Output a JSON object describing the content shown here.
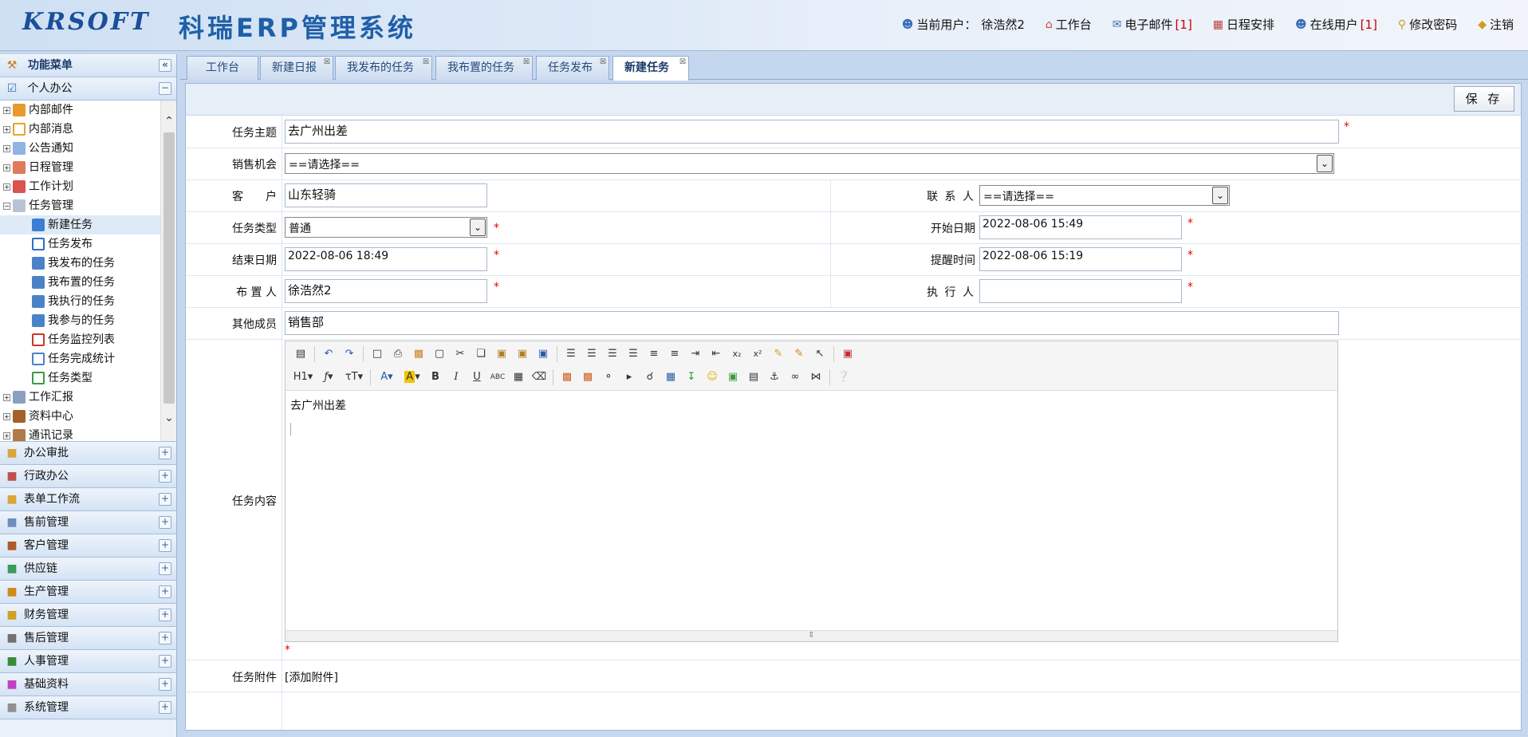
{
  "header": {
    "logo_text": "KRSOFT",
    "system_name": "科瑞ERP管理系统",
    "current_user_label": "当前用户：",
    "current_user": "徐浩然2",
    "nav": {
      "workbench": "工作台",
      "email": "电子邮件",
      "email_count": "[1]",
      "schedule": "日程安排",
      "online_users": "在线用户",
      "online_count": "[1]",
      "change_password": "修改密码",
      "logout": "注销"
    }
  },
  "sidebar": {
    "title": "功能菜单",
    "collapse_symbol": "«",
    "personal_office": "个人办公",
    "tree": {
      "internal_mail": "内部邮件",
      "internal_msg": "内部消息",
      "notice": "公告通知",
      "schedule_mgmt": "日程管理",
      "work_plan": "工作计划",
      "task_mgmt": "任务管理",
      "new_task": "新建任务",
      "task_publish": "任务发布",
      "my_published": "我发布的任务",
      "my_assigned": "我布置的任务",
      "my_executed": "我执行的任务",
      "my_participated": "我参与的任务",
      "task_monitor": "任务监控列表",
      "task_stats": "任务完成统计",
      "task_type": "任务类型",
      "work_report": "工作汇报",
      "data_center": "资料中心",
      "contacts": "通讯记录"
    },
    "sections": [
      "办公审批",
      "行政办公",
      "表单工作流",
      "售前管理",
      "客户管理",
      "供应链",
      "生产管理",
      "财务管理",
      "售后管理",
      "人事管理",
      "基础资料",
      "系统管理"
    ]
  },
  "tabs": [
    "工作台",
    "新建日报",
    "我发布的任务",
    "我布置的任务",
    "任务发布",
    "新建任务"
  ],
  "form": {
    "save_label": "保 存",
    "subject_label": "任务主题",
    "subject_value": "去广州出差",
    "opportunity_label": "销售机会",
    "opportunity_value": "==请选择==",
    "customer_label": "客　　户",
    "customer_value": "山东轻骑",
    "contact_label": "联 系 人",
    "contact_value": "==请选择==",
    "task_type_label": "任务类型",
    "task_type_value": "普通",
    "start_date_label": "开始日期",
    "start_date_value": "2022-08-06 15:49",
    "end_date_label": "结束日期",
    "end_date_value": "2022-08-06 18:49",
    "remind_label": "提醒时间",
    "remind_value": "2022-08-06 15:19",
    "assigner_label": "布 置 人",
    "assigner_value": "徐浩然2",
    "executor_label": "执 行 人",
    "executor_value": "",
    "members_label": "其他成员",
    "members_value": "销售部",
    "content_label": "任务内容",
    "content_value": "去广州出差",
    "attach_label": "任务附件",
    "attach_link": "[添加附件]",
    "required_mark": "*"
  }
}
